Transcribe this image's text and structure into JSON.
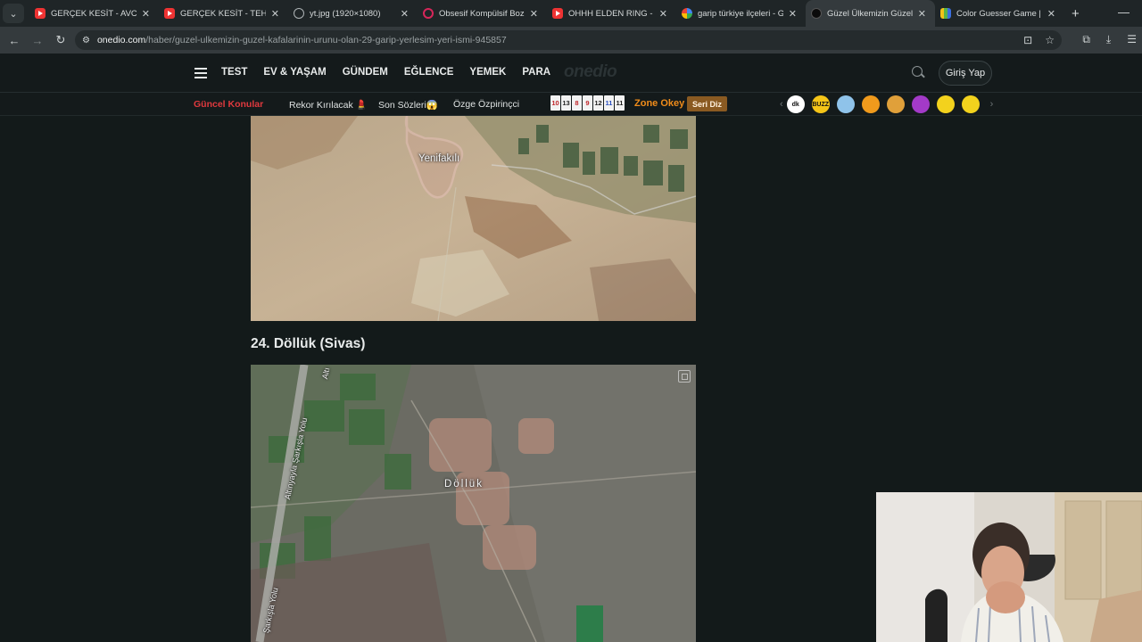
{
  "browser": {
    "tabs": [
      {
        "title": "GERÇEK KESİT - AVCI - You",
        "favicon": "youtube-icon",
        "active": false
      },
      {
        "title": "GERÇEK KESİT - TEHLİKELİ",
        "favicon": "youtube-icon",
        "active": false
      },
      {
        "title": "yt.jpg (1920×1080)",
        "favicon": "globe-icon",
        "active": false
      },
      {
        "title": "Obsesif Kompülsif Bozukl",
        "favicon": "obsesif-icon",
        "active": false
      },
      {
        "title": "OHHH ELDEN RING - You",
        "favicon": "youtube-icon",
        "active": false
      },
      {
        "title": "garip türkiye ilçeleri - Goo",
        "favicon": "google-icon",
        "active": false
      },
      {
        "title": "Güzel Ülkemizin Güzel Ka",
        "favicon": "onedio-icon",
        "active": true
      },
      {
        "title": "Color Guesser Game | Gu",
        "favicon": "color-guesser-icon",
        "active": false
      }
    ],
    "url_host": "onedio.com",
    "url_path": "/haber/guzel-ulkemizin-guzel-kafalarinin-urunu-olan-29-garip-yerlesim-yeri-ismi-945857"
  },
  "site": {
    "nav": [
      "TEST",
      "EV & YAŞAM",
      "GÜNDEM",
      "EĞLENCE",
      "YEMEK",
      "PARA"
    ],
    "logo": "onedio",
    "login_label": "Giriş Yap",
    "topics": {
      "hot": "Güncel Konular",
      "t1": "Rekor Kırılacak 💄",
      "t2": "Son Sözleri😱",
      "t3": "Özge Özpirinçci"
    },
    "tiles": [
      "10",
      "13",
      "8",
      "9",
      "12",
      "11",
      "11"
    ],
    "zone_label": "Zone Okey",
    "seri_label": "Seri Diz",
    "badges": [
      {
        "label": "dk",
        "color": "#ffffff"
      },
      {
        "label": "BUZZ",
        "color": "#f5c518"
      },
      {
        "label": "",
        "color": "#8fc3ea"
      },
      {
        "label": "",
        "color": "#f09a1c"
      },
      {
        "label": "",
        "color": "#e0a03a"
      },
      {
        "label": "",
        "color": "#a33ac8"
      },
      {
        "label": "",
        "color": "#f3d21d"
      },
      {
        "label": "",
        "color": "#f2d21d"
      }
    ]
  },
  "article": {
    "map1_label": "Yenifakılı",
    "heading": "24. Döllük (Sivas)",
    "map2_label": "Döllük",
    "road_labels": [
      "Altınyayla Şarkışla Yolu",
      "Şarkışla Yolu",
      "Altı"
    ]
  }
}
